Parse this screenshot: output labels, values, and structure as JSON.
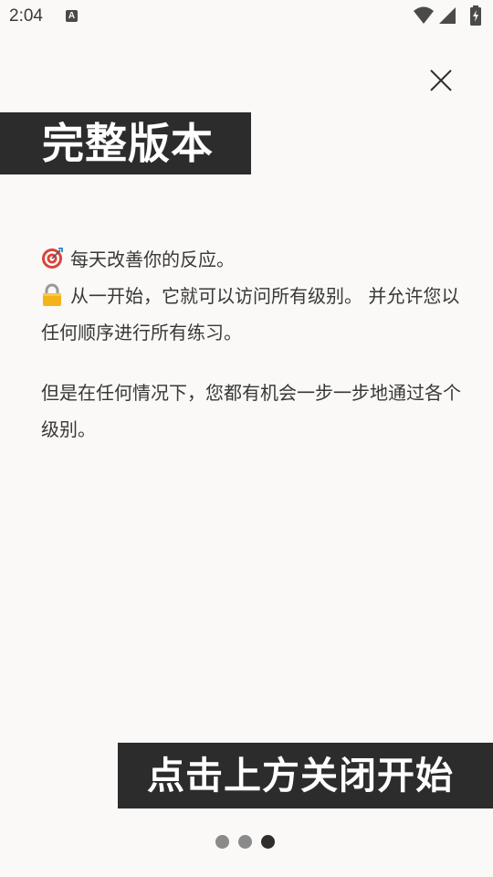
{
  "status_bar": {
    "time": "2:04",
    "notification_icon_letter": "A",
    "icons": [
      "wifi-icon",
      "cellular-signal-icon",
      "battery-charging-icon"
    ]
  },
  "close_icon": "close-icon",
  "title": "完整版本",
  "body": {
    "line1_icon": "target-emoji",
    "line1": "每天改善你的反应。",
    "line2_icon": "lock-emoji",
    "line2": "从一开始，它就可以访问所有级别。 并允许您以任何顺序进行所有练习。",
    "para2": "但是在任何情况下，您都有机会一步一步地通过各个级别。"
  },
  "cta": "点击上方关闭开始",
  "pagination": {
    "total": 3,
    "current": 3
  },
  "colors": {
    "background": "#faf9f7",
    "banner": "#2c2c2c",
    "banner_text": "#ffffff",
    "body_text": "#383838",
    "dot_inactive": "#8a8a8a",
    "dot_active": "#2e2e2e"
  }
}
